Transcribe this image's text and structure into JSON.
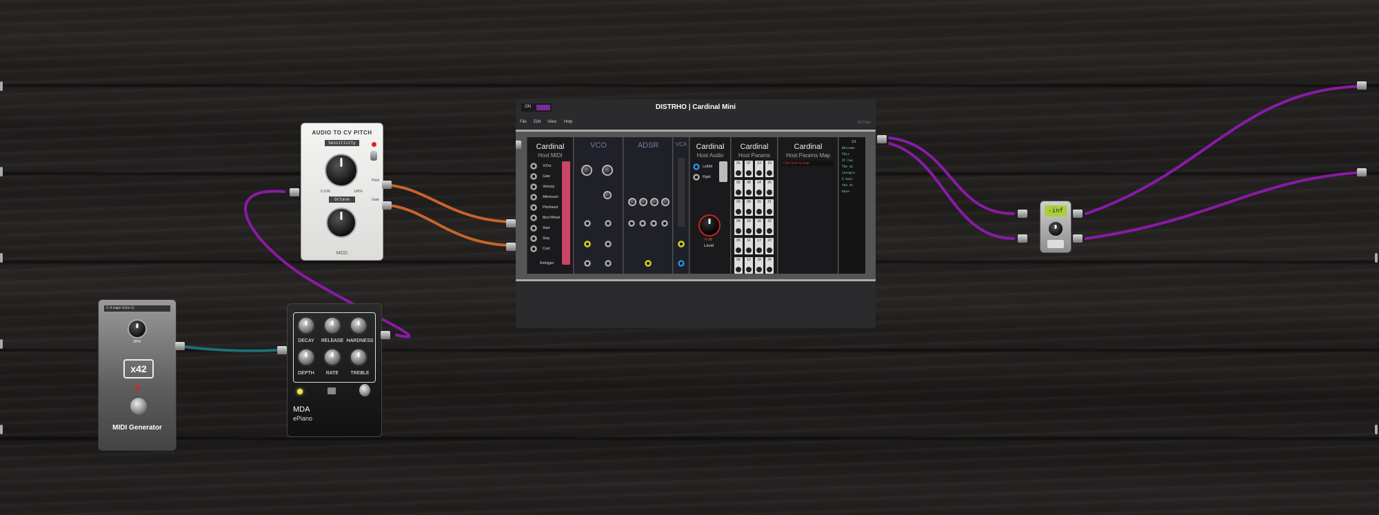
{
  "window": {
    "title": "DISTRHO | Cardinal Mini",
    "power_label": "ON",
    "fps": "60.3 fps",
    "menu": [
      "File",
      "Edit",
      "View",
      "Help"
    ]
  },
  "audio_to_cv": {
    "title": "AUDIO TO CV PITCH",
    "sensitivity_label": "Sensitivity",
    "octave_label": "Octave",
    "pitch_label": "Pitch",
    "gate_label": "Gate",
    "brand": "MOD",
    "scale_min": "0.10%",
    "scale_max": "100%"
  },
  "midi_generator": {
    "preset": "C-4 major Echo 1)",
    "bpm_label": "BPM",
    "value": "x42",
    "name": "MIDI Generator"
  },
  "mda_epiano": {
    "knobs": [
      "DECAY",
      "RELEASE",
      "HARDNESS",
      "DEPTH",
      "RATE",
      "TREBLE"
    ],
    "brand": "MDA",
    "name": "ePiano"
  },
  "cardinal": {
    "host_midi": {
      "brand": "Cardinal",
      "sub": "Host MIDI",
      "rows": [
        "V/Oct",
        "Gate",
        "Velocity",
        "Aftertouch",
        "Pitchbend",
        "Mod Wheel",
        "Start",
        "Stop",
        "Cont",
        "Retrigger"
      ]
    },
    "vco": {
      "title": "VCO"
    },
    "adsr": {
      "title": "ADSR"
    },
    "vca": {
      "title": "VCA"
    },
    "host_audio": {
      "brand": "Cardinal",
      "sub": "Host Audio",
      "left": "Left/M",
      "right": "Right",
      "level_label": "Level",
      "db": "-6 dB"
    },
    "host_params": {
      "brand": "Cardinal",
      "sub": "Host Params",
      "cells": [
        "01",
        "07",
        "13",
        "19",
        "02",
        "08",
        "14",
        "20",
        "03",
        "09",
        "15",
        "21",
        "04",
        "10",
        "16",
        "22",
        "05",
        "11",
        "17",
        "23",
        "06",
        "12",
        "18",
        "24"
      ]
    },
    "host_params_map": {
      "brand": "Cardinal",
      "sub": "Host Params Map",
      "hint": "Click here to map"
    },
    "notes": {
      "page": "1/1",
      "lines": [
        "Welcome",
        "This",
        "It has",
        "The mi",
        "integra",
        "A basi",
        "the dr",
        "Have"
      ]
    }
  },
  "tuner": {
    "display": "-inf"
  },
  "colors": {
    "orange_cable": "#c8642a",
    "purple_cable": "#8a1aa8",
    "teal_cable": "#1f6f7a",
    "accent_purple": "#7b2a9a"
  }
}
